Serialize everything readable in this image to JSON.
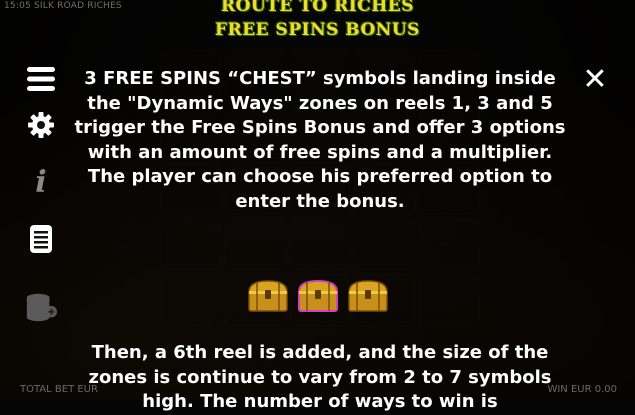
{
  "top_info": "15:05 SILK ROAD RICHES",
  "title": {
    "line1": "ROUTE TO RICHES",
    "line2": "FREE SPINS BONUS"
  },
  "sidebar": {
    "icons": [
      "menu-icon",
      "settings-gear-icon",
      "info-icon",
      "paytable-icon",
      "coin-stack-icon"
    ]
  },
  "close_label": "✕",
  "paragraph1": "3 FREE SPINS “CHEST” symbols landing inside the \"Dynamic Ways\" zones on reels 1, 3 and 5 trigger the Free Spins Bonus and offer 3 options with an amount of free spins and a multiplier.",
  "paragraph2": "The player can choose his preferred option to enter the bonus.",
  "paragraph3": "Then, a 6th reel is added, and the size of the zones is continue to vary from 2 to 7 symbols high. The number of ways to win is",
  "chests": [
    "chest-icon",
    "chest-icon-highlighted",
    "chest-icon"
  ],
  "bottom": {
    "total_bet": "TOTAL BET EUR",
    "win": "WIN EUR 0.00"
  },
  "colors": {
    "title": "#f5d92a",
    "title_outline": "#2d5a0c",
    "chest_gold": "#d9a520",
    "chest_highlight": "#d040c0"
  }
}
